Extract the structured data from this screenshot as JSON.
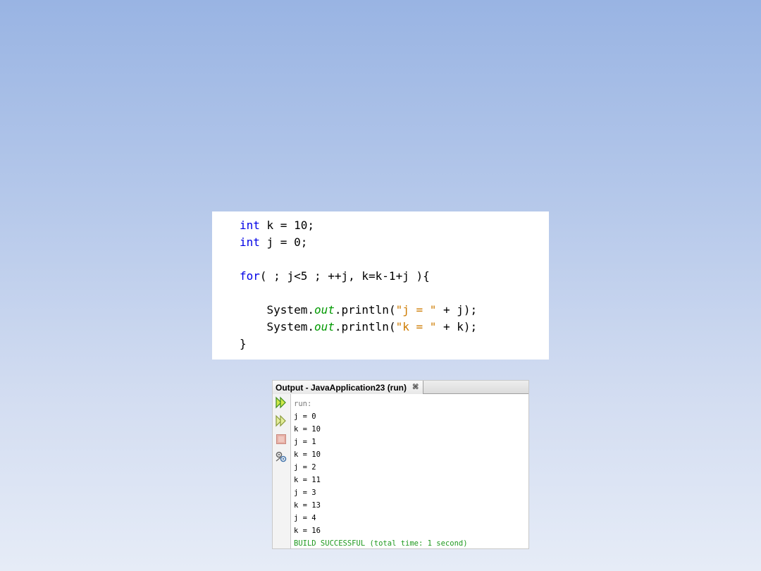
{
  "code": {
    "lines": [
      [
        {
          "t": "int",
          "c": "kw"
        },
        {
          "t": " k = 10;",
          "c": ""
        }
      ],
      [
        {
          "t": "int",
          "c": "kw"
        },
        {
          "t": " j = 0;",
          "c": ""
        }
      ],
      [],
      [
        {
          "t": "for",
          "c": "kw"
        },
        {
          "t": "( ; j<5 ; ++j, k=k-1+j ){",
          "c": ""
        }
      ],
      [],
      [
        {
          "t": "    System.",
          "c": ""
        },
        {
          "t": "out",
          "c": "fld"
        },
        {
          "t": ".println(",
          "c": ""
        },
        {
          "t": "\"j = \"",
          "c": "str"
        },
        {
          "t": " + j);",
          "c": ""
        }
      ],
      [
        {
          "t": "    System.",
          "c": ""
        },
        {
          "t": "out",
          "c": "fld"
        },
        {
          "t": ".println(",
          "c": ""
        },
        {
          "t": "\"k = \"",
          "c": "str"
        },
        {
          "t": " + k);",
          "c": ""
        }
      ],
      [
        {
          "t": "}",
          "c": ""
        }
      ]
    ]
  },
  "output": {
    "tab_title": "Output - JavaApplication23 (run)",
    "close_glyph": "⌘",
    "toolbar_icons": [
      "rerun-icon",
      "rerun-with-args-icon",
      "stop-icon",
      "settings-icon"
    ],
    "lines": [
      {
        "text": "run:",
        "kind": "run"
      },
      {
        "text": "j = 0",
        "kind": "normal"
      },
      {
        "text": "k = 10",
        "kind": "normal"
      },
      {
        "text": "j = 1",
        "kind": "normal"
      },
      {
        "text": "k = 10",
        "kind": "normal"
      },
      {
        "text": "j = 2",
        "kind": "normal"
      },
      {
        "text": "k = 11",
        "kind": "normal"
      },
      {
        "text": "j = 3",
        "kind": "normal"
      },
      {
        "text": "k = 13",
        "kind": "normal"
      },
      {
        "text": "j = 4",
        "kind": "normal"
      },
      {
        "text": "k = 16",
        "kind": "normal"
      },
      {
        "text": "BUILD SUCCESSFUL (total time: 1 second)",
        "kind": "success"
      }
    ]
  },
  "colors": {
    "keyword": "#0000e6",
    "field": "#009900",
    "string": "#ce7b00",
    "run_text": "#7a7a7a",
    "success_text": "#1f9a1f"
  }
}
